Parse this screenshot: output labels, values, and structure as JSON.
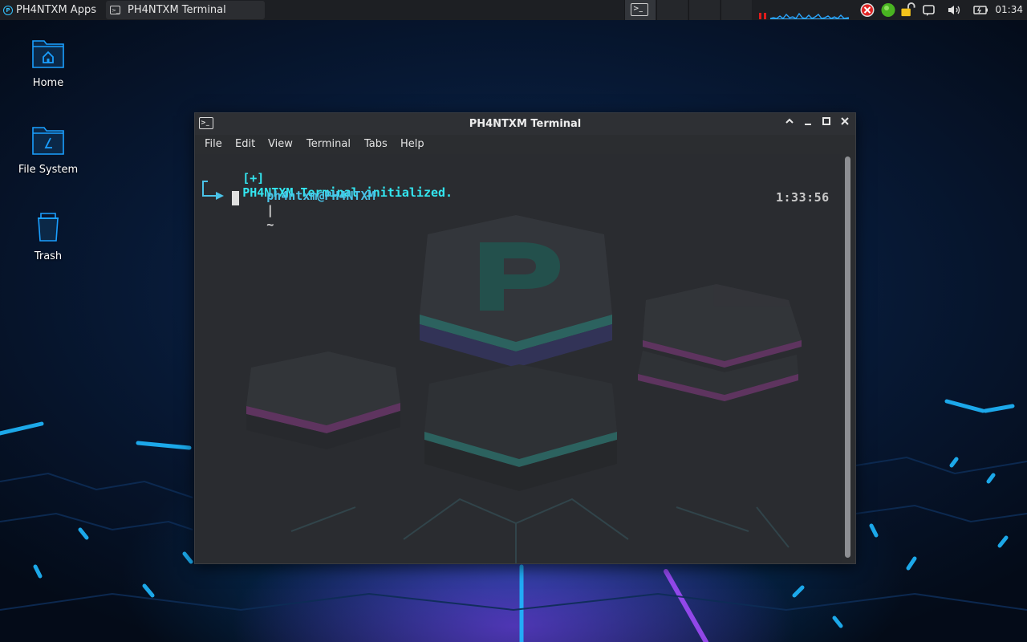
{
  "panel": {
    "apps_label": "PH4NTXM Apps",
    "taskbar": [
      {
        "title": "PH4NTXM Terminal",
        "active": true
      }
    ],
    "clock": "01:34"
  },
  "desktop": {
    "icons": [
      {
        "label": "Home",
        "icon": "home-folder-icon"
      },
      {
        "label": "File System",
        "icon": "filesystem-folder-icon"
      },
      {
        "label": "Trash",
        "icon": "trash-icon"
      }
    ]
  },
  "terminal": {
    "window_title": "PH4NTXM Terminal",
    "menu": [
      "File",
      "Edit",
      "View",
      "Terminal",
      "Tabs",
      "Help"
    ],
    "lines": {
      "init_prefix": "[+]",
      "init_message": "PH4NTXM Terminal initialized.",
      "prompt_user": "ph4ntxm@PH4NTXM",
      "prompt_sep": "|",
      "prompt_dir": "~"
    },
    "timer": "1:33:56"
  },
  "colors": {
    "accent": "#33e6f0",
    "panel_bg": "#1d1f23",
    "window_bg": "#2b2d30"
  }
}
